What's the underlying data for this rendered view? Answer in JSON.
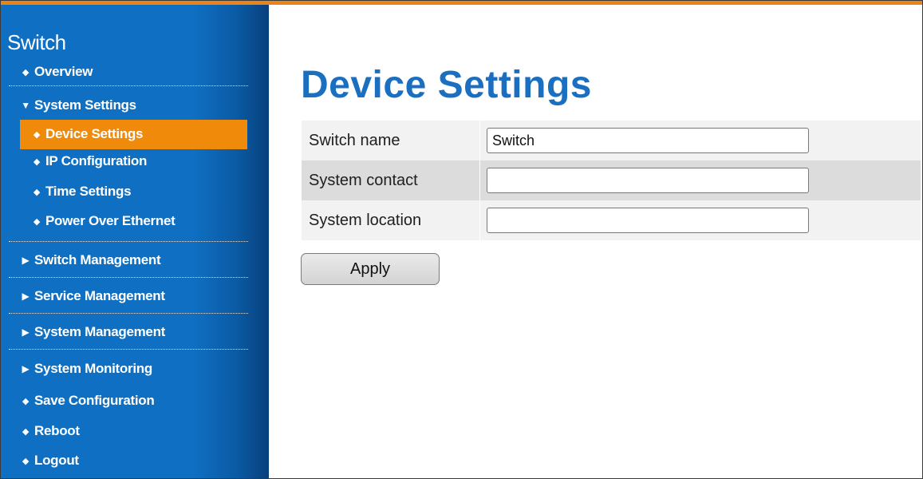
{
  "colors": {
    "accent_orange": "#f08a0a",
    "sidebar_blue": "#0f6fc2",
    "title_blue": "#1b6fc0"
  },
  "sidebar": {
    "brand": "Switch",
    "items": [
      {
        "label": "Overview",
        "icon": "diamond-bullet"
      },
      {
        "label": "System Settings",
        "icon": "triangle-down"
      },
      {
        "label": "Device Settings",
        "icon": "diamond-bullet",
        "active": true
      },
      {
        "label": "IP Configuration",
        "icon": "diamond-bullet"
      },
      {
        "label": "Time Settings",
        "icon": "diamond-bullet"
      },
      {
        "label": "Power Over Ethernet",
        "icon": "diamond-bullet"
      },
      {
        "label": "Switch Management",
        "icon": "triangle-right"
      },
      {
        "label": "Service Management",
        "icon": "triangle-right"
      },
      {
        "label": "System Management",
        "icon": "triangle-right"
      },
      {
        "label": "System Monitoring",
        "icon": "triangle-right"
      },
      {
        "label": "Save Configuration",
        "icon": "diamond-bullet"
      },
      {
        "label": "Reboot",
        "icon": "diamond-bullet"
      },
      {
        "label": "Logout",
        "icon": "diamond-bullet"
      }
    ]
  },
  "main": {
    "title": "Device Settings",
    "fields": [
      {
        "label": "Switch name",
        "value": "Switch",
        "placeholder": ""
      },
      {
        "label": "System contact",
        "value": "",
        "placeholder": ""
      },
      {
        "label": "System location",
        "value": "",
        "placeholder": ""
      }
    ],
    "apply_label": "Apply"
  }
}
